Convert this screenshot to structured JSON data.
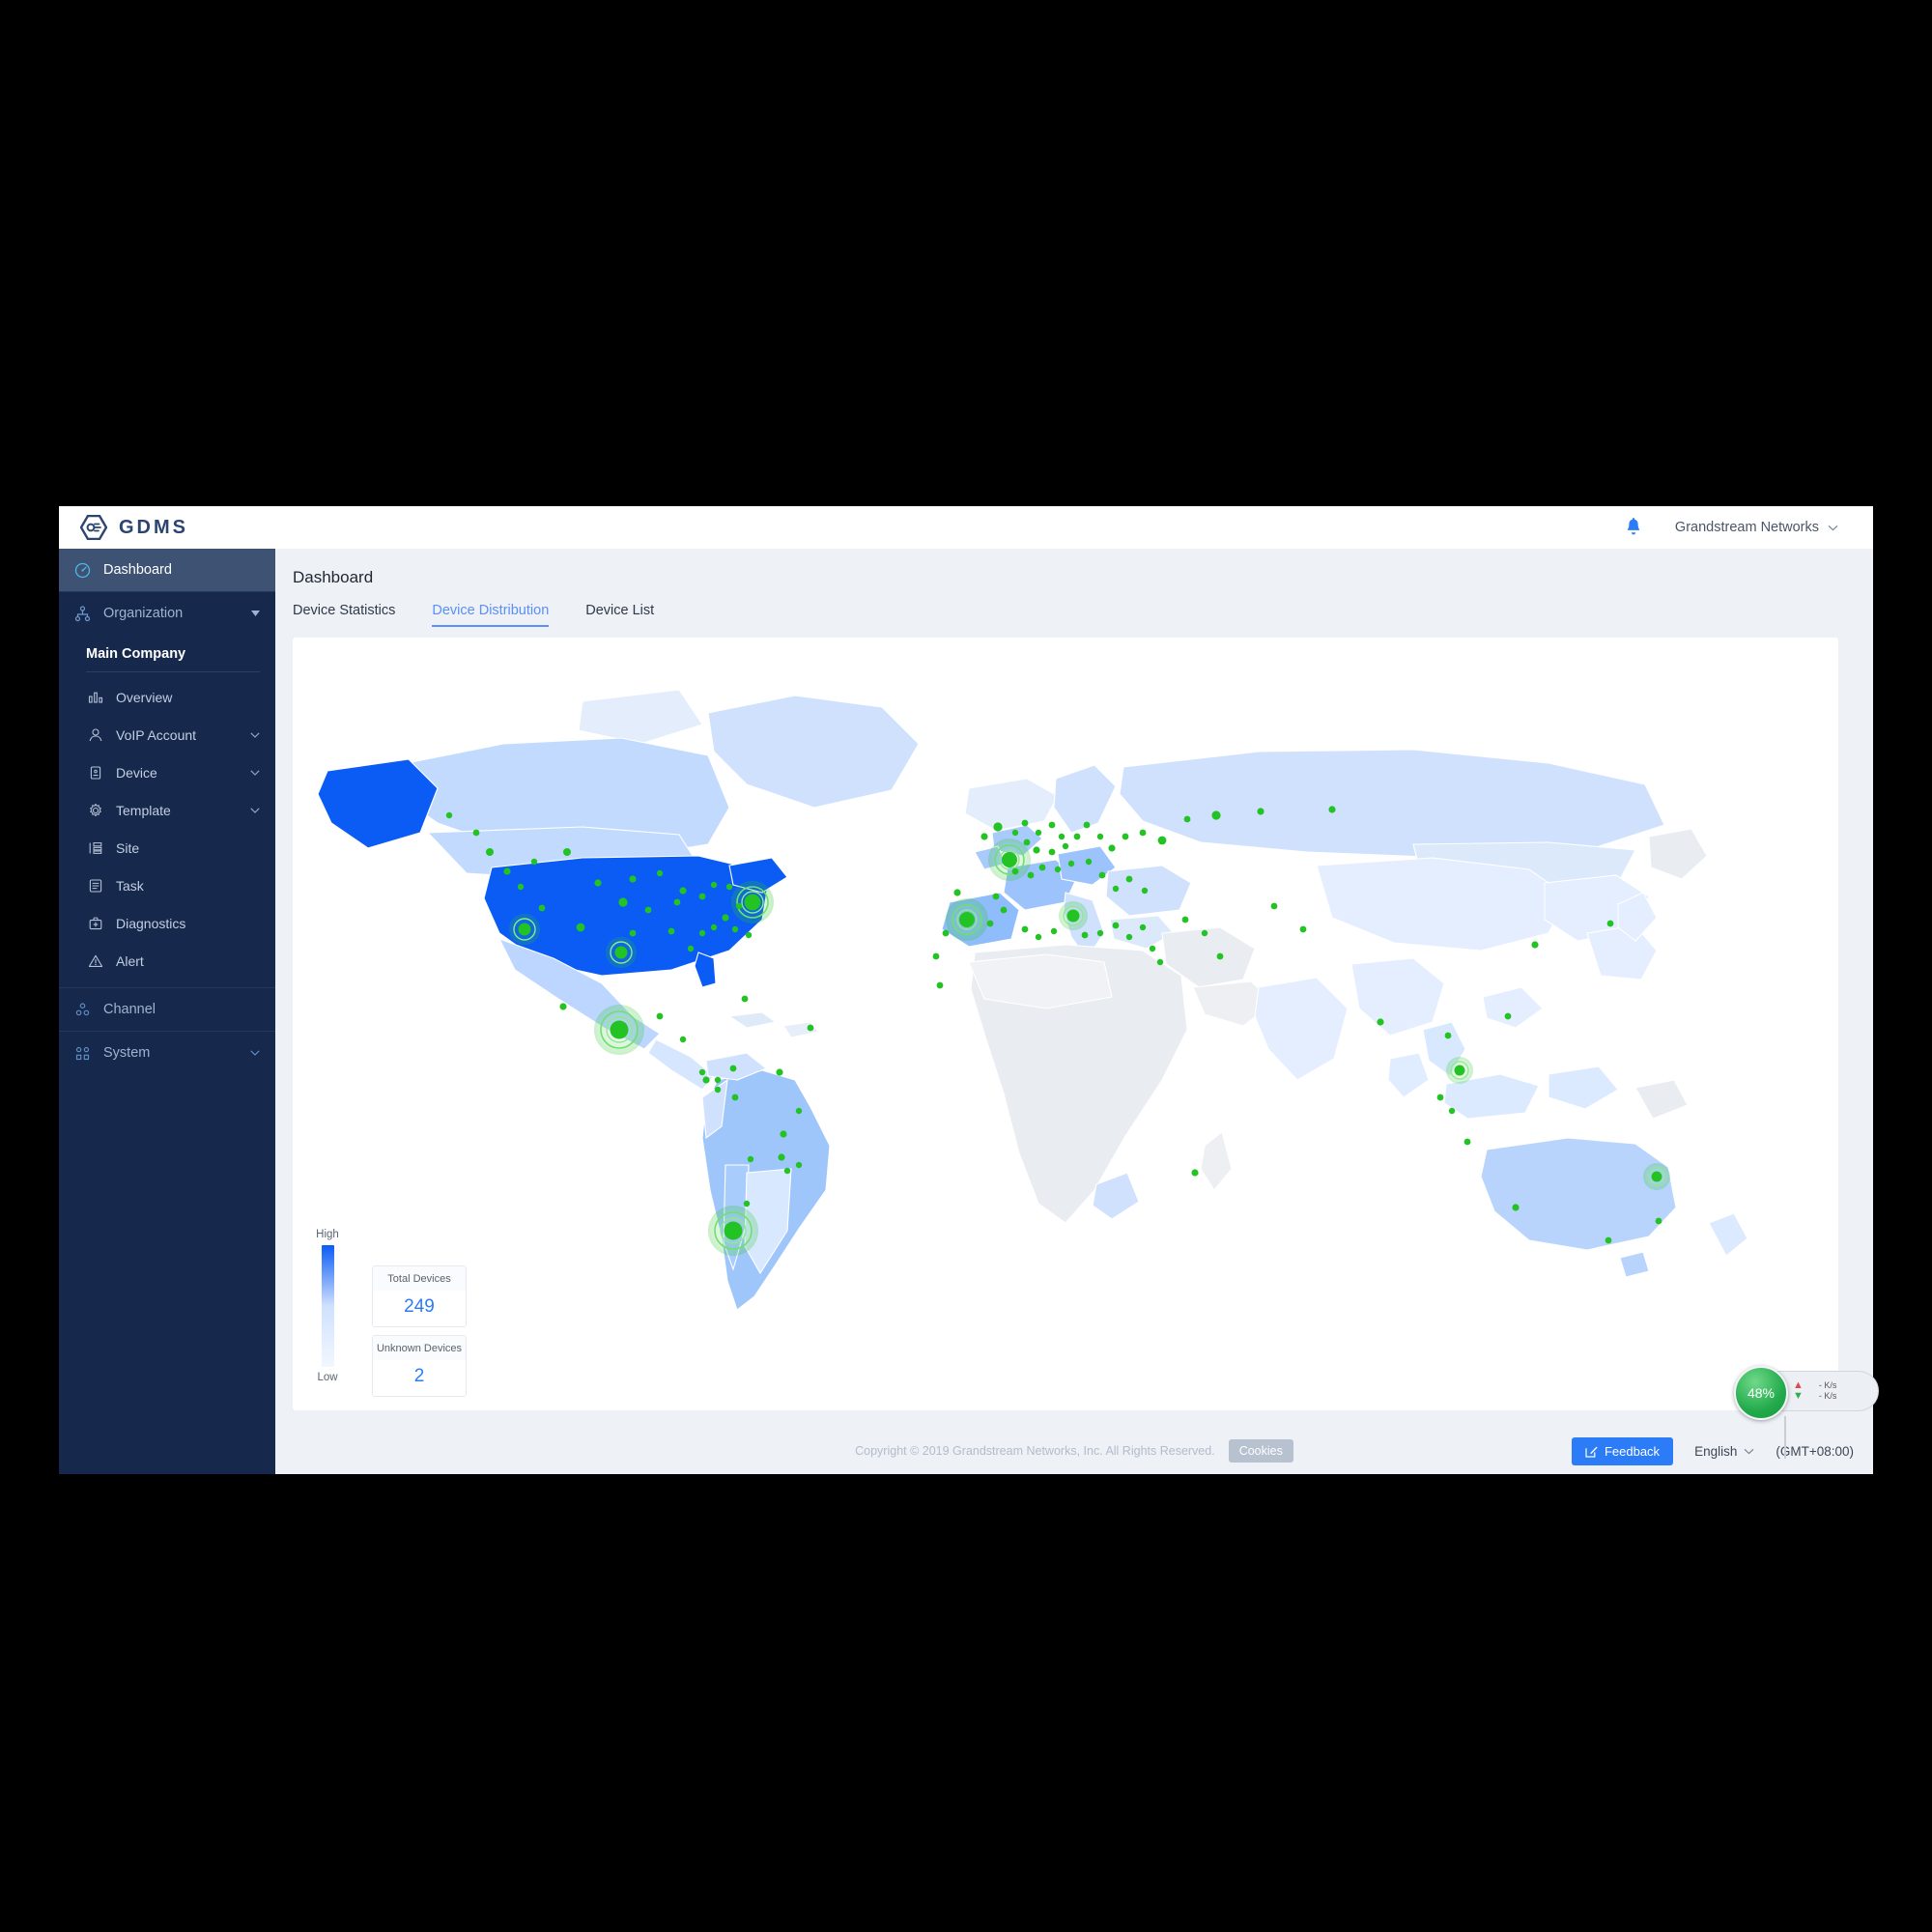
{
  "app": {
    "brand": "GDMS",
    "brand_logo_icon": "gdms-hexagon-logo",
    "notification_icon": "bell-icon",
    "account_name": "Grandstream Networks",
    "account_chevron_icon": "chevron-down-icon"
  },
  "sidebar": {
    "dashboard": {
      "label": "Dashboard",
      "icon": "speedometer-icon"
    },
    "organization": {
      "label": "Organization",
      "icon": "org-tree-icon",
      "caret": "caret-down-icon"
    },
    "company": "Main Company",
    "items": [
      {
        "label": "Overview",
        "icon": "bar-chart-icon",
        "caret": ""
      },
      {
        "label": "VoIP Account",
        "icon": "user-icon",
        "caret": "chevron-down-icon"
      },
      {
        "label": "Device",
        "icon": "device-icon",
        "caret": "chevron-down-icon"
      },
      {
        "label": "Template",
        "icon": "gear-icon",
        "caret": "chevron-down-icon"
      },
      {
        "label": "Site",
        "icon": "site-list-icon",
        "caret": ""
      },
      {
        "label": "Task",
        "icon": "task-list-icon",
        "caret": ""
      },
      {
        "label": "Diagnostics",
        "icon": "toolkit-icon",
        "caret": ""
      },
      {
        "label": "Alert",
        "icon": "warning-triangle-icon",
        "caret": ""
      }
    ],
    "channel": {
      "label": "Channel",
      "icon": "channel-nodes-icon"
    },
    "system": {
      "label": "System",
      "icon": "grid-squares-icon",
      "caret": "chevron-down-icon"
    }
  },
  "main": {
    "page_title": "Dashboard",
    "tabs": [
      {
        "label": "Device Statistics",
        "active": false
      },
      {
        "label": "Device Distribution",
        "active": true
      },
      {
        "label": "Device List",
        "active": false
      }
    ]
  },
  "map": {
    "legend": {
      "high": "High",
      "low": "Low"
    },
    "stats": [
      {
        "label": "Total Devices",
        "value": "249"
      },
      {
        "label": "Unknown Devices",
        "value": "2"
      }
    ]
  },
  "footer": {
    "copyright": "Copyright © 2019 Grandstream Networks, Inc. All Rights Reserved.",
    "cookies": "Cookies",
    "feedback": {
      "label": "Feedback",
      "icon": "edit-square-icon"
    },
    "language": {
      "label": "English",
      "icon": "chevron-down-icon"
    },
    "timezone": "(GMT+08:00)"
  },
  "speed_widget": {
    "percent": "48%",
    "upload": "- K/s",
    "download": "- K/s",
    "upload_icon": "arrow-up-icon",
    "download_icon": "arrow-down-icon"
  },
  "colors": {
    "accent": "#2b7cf6",
    "sidebar": "#16284b",
    "sidebar_active": "#3e5273",
    "marker": "#22c322",
    "map_high": "#0b5cf5"
  },
  "chart_data": {
    "type": "map",
    "title": "Device Distribution",
    "metric": "devices",
    "legend": {
      "scale": [
        "Low",
        "High"
      ],
      "colors": [
        "#f2f7ff",
        "#0b5cf5"
      ]
    },
    "totals": {
      "total_devices": 249,
      "unknown_devices": 2
    },
    "choropleth": [
      {
        "region": "United States",
        "level": "high",
        "color": "#0b5cf5"
      },
      {
        "region": "Alaska (US)",
        "level": "high",
        "color": "#0b5cf5"
      },
      {
        "region": "Canada",
        "level": "low",
        "color": "#c3daff"
      },
      {
        "region": "Mexico",
        "level": "low",
        "color": "#bcd6ff"
      },
      {
        "region": "Brazil",
        "level": "medium",
        "color": "#9fc6fb"
      },
      {
        "region": "Chile",
        "level": "medium",
        "color": "#a8ccfc"
      },
      {
        "region": "Argentina",
        "level": "low",
        "color": "#d8e8ff"
      },
      {
        "region": "Colombia",
        "level": "low",
        "color": "#cfe1fd"
      },
      {
        "region": "Spain",
        "level": "medium",
        "color": "#8fbcfa"
      },
      {
        "region": "France",
        "level": "medium",
        "color": "#9cc3fb"
      },
      {
        "region": "United Kingdom",
        "level": "medium",
        "color": "#a9cbfc"
      },
      {
        "region": "Germany",
        "level": "medium",
        "color": "#9cc3fb"
      },
      {
        "region": "Italy",
        "level": "low",
        "color": "#cfe1fd"
      },
      {
        "region": "Russia",
        "level": "low",
        "color": "#cfe1fd"
      },
      {
        "region": "China",
        "level": "low",
        "color": "#e4eeff"
      },
      {
        "region": "India",
        "level": "low",
        "color": "#e4eeff"
      },
      {
        "region": "Australia",
        "level": "low",
        "color": "#b8d4fd"
      },
      {
        "region": "Indonesia",
        "level": "low",
        "color": "#d8e8ff"
      },
      {
        "region": "Africa (most)",
        "level": "none",
        "color": "#e9ecf1"
      }
    ],
    "markers_note": "green device markers; larger markers with concentric ripple rings mark high-count cities",
    "ripple_markers": [
      {
        "city": "Boston / Northeast US",
        "size": "large"
      },
      {
        "city": "Los Angeles",
        "size": "medium"
      },
      {
        "city": "Houston",
        "size": "medium"
      },
      {
        "city": "Mexico City",
        "size": "large"
      },
      {
        "city": "Santiago, Chile",
        "size": "large"
      },
      {
        "city": "Paris / Western Europe",
        "size": "large"
      },
      {
        "city": "Madrid",
        "size": "large"
      },
      {
        "city": "Rome",
        "size": "medium"
      },
      {
        "city": "Kuala Lumpur",
        "size": "medium"
      },
      {
        "city": "Brisbane",
        "size": "medium"
      }
    ]
  }
}
